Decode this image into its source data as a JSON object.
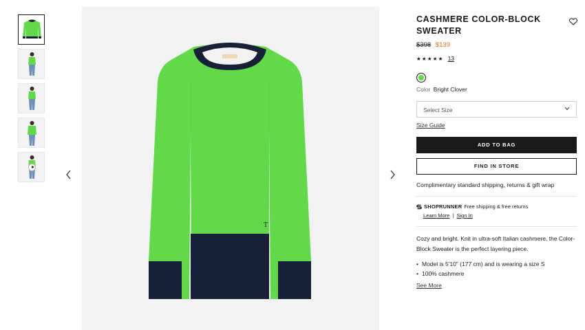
{
  "gallery": {
    "thumbnails": [
      {
        "name": "thumb-front-flat",
        "kind": "flat"
      },
      {
        "name": "thumb-model-front",
        "kind": "model"
      },
      {
        "name": "thumb-model-back",
        "kind": "model"
      },
      {
        "name": "thumb-model-close",
        "kind": "model"
      },
      {
        "name": "thumb-video",
        "kind": "video"
      }
    ],
    "prev_icon": "chevron-left-icon",
    "next_icon": "chevron-right-icon"
  },
  "product": {
    "title": "CASHMERE COLOR-BLOCK SWEATER",
    "price_original": "$398",
    "price_sale": "$139",
    "rating": 4.5,
    "rating_stars": "★★★★★",
    "review_count": "13",
    "color_label": "Color",
    "color_name": "Bright Clover",
    "swatch_color": "#62d94a",
    "size_placeholder": "Select Size",
    "size_guide": "Size Guide",
    "add_to_bag": "ADD TO BAG",
    "find_in_store": "FIND IN STORE",
    "shipping_note": "Complimentary standard shipping, returns & gift wrap",
    "shoprunner_name": "SHOPRUNNER",
    "shoprunner_msg": "Free shipping & free returns",
    "learn_more": "Learn More",
    "link_separator": "|",
    "sign_in": "Sign In",
    "description": "Cozy and bright. Knit in ultra-soft Italian cashmere, the Color-Block Sweater is the perfect layering piece.",
    "details": [
      "Model is 5'10\" (177 cm) and is wearing a size S",
      "100% cashmere"
    ],
    "see_more": "See More"
  },
  "colors": {
    "sweater_green": "#62d94a",
    "navy": "#172036",
    "sale": "#e1711b",
    "dark": "#1a1a1a"
  }
}
